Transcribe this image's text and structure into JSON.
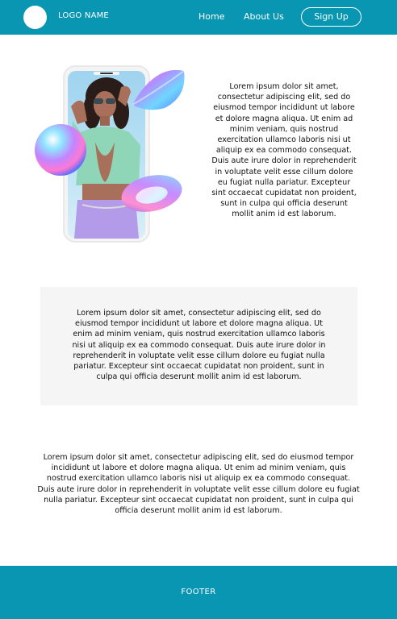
{
  "header": {
    "logo_name": "LOGO NAME",
    "nav": {
      "home": "Home",
      "about": "About Us"
    },
    "signup_label": "Sign Up"
  },
  "hero": {
    "image_icon": "phone-photo-illustration",
    "text": "Lorem ipsum dolor sit amet, consectetur adipiscing elit, sed do eiusmod tempor incididunt ut labore et dolore magna aliqua. Ut enim ad minim veniam, quis nostrud exercitation ullamco laboris nisi ut aliquip ex ea commodo consequat. Duis aute irure dolor in reprehenderit in voluptate velit esse cillum dolore eu fugiat nulla pariatur. Excepteur sint occaecat cupidatat non proident, sunt in culpa qui officia deserunt mollit anim id est laborum."
  },
  "gray_box": {
    "text": "Lorem ipsum dolor sit amet, consectetur adipiscing elit, sed do eiusmod tempor incididunt ut labore et dolore magna aliqua. Ut enim ad minim veniam, quis nostrud exercitation ullamco laboris nisi ut aliquip ex ea commodo consequat. Duis aute irure dolor in reprehenderit in voluptate velit esse cillum dolore eu fugiat nulla pariatur. Excepteur sint occaecat cupidatat non proident, sunt in culpa qui officia deserunt mollit anim id est laborum."
  },
  "wide_section": {
    "text": "Lorem ipsum dolor sit amet, consectetur adipiscing elit, sed do eiusmod tempor incididunt ut labore et dolore magna aliqua. Ut enim ad minim veniam, quis nostrud exercitation ullamco laboris nisi ut aliquip ex ea commodo consequat. Duis aute irure dolor in reprehenderit in voluptate velit esse cillum dolore eu fugiat nulla pariatur. Excepteur sint occaecat cupidatat non proident, sunt in culpa qui officia deserunt mollit anim id est laborum."
  },
  "footer": {
    "label": "FOOTER"
  },
  "colors": {
    "brand": "#0896b3",
    "panel": "#f5f5f5",
    "text": "#111111"
  }
}
